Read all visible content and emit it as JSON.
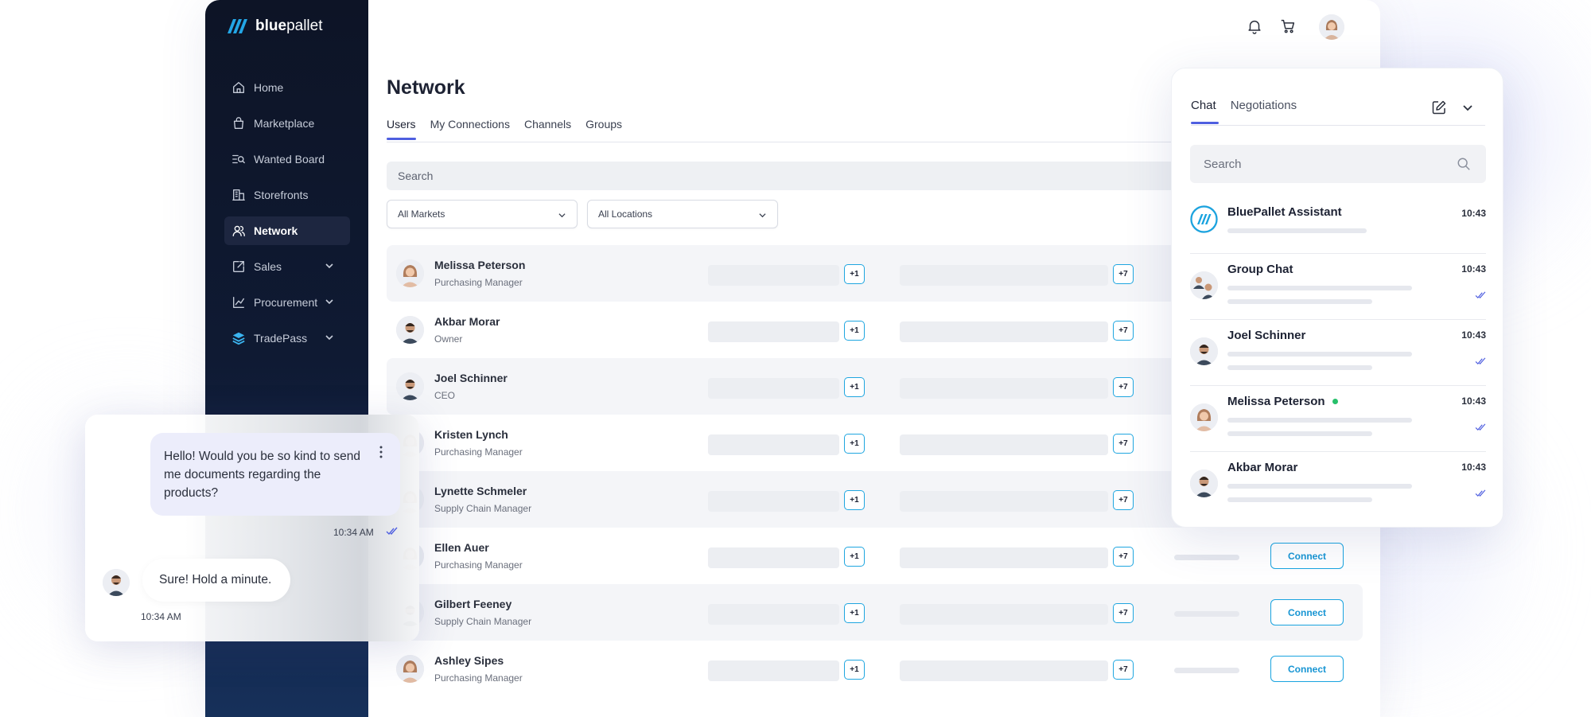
{
  "brand": {
    "name_bold": "blue",
    "name_rest": "pallet"
  },
  "sidebar": {
    "items": [
      {
        "label": "Home",
        "icon": "home-icon",
        "active": false,
        "expandable": false
      },
      {
        "label": "Marketplace",
        "icon": "bag-icon",
        "active": false,
        "expandable": false
      },
      {
        "label": "Wanted Board",
        "icon": "search-list-icon",
        "active": false,
        "expandable": false
      },
      {
        "label": "Storefronts",
        "icon": "building-icon",
        "active": false,
        "expandable": false
      },
      {
        "label": "Network",
        "icon": "users-icon",
        "active": true,
        "expandable": false
      },
      {
        "label": "Sales",
        "icon": "export-icon",
        "active": false,
        "expandable": true
      },
      {
        "label": "Procurement",
        "icon": "chart-icon",
        "active": false,
        "expandable": true
      },
      {
        "label": "TradePass",
        "icon": "tradepass-icon",
        "active": false,
        "expandable": true
      }
    ]
  },
  "header": {
    "icons": [
      "bell-icon",
      "cart-icon",
      "avatar"
    ]
  },
  "main": {
    "title": "Network",
    "tabs": [
      {
        "label": "Users",
        "active": true
      },
      {
        "label": "My Connections",
        "active": false
      },
      {
        "label": "Channels",
        "active": false
      },
      {
        "label": "Groups",
        "active": false
      }
    ],
    "search_placeholder": "Search",
    "filters": [
      "All Markets",
      "All Locations"
    ],
    "rows": [
      {
        "name": "Melissa Peterson",
        "role": "Purchasing Manager",
        "badge1": "+1",
        "badge2": "+7",
        "connect": ""
      },
      {
        "name": "Akbar Morar",
        "role": "Owner",
        "badge1": "+1",
        "badge2": "+7",
        "connect": ""
      },
      {
        "name": "Joel Schinner",
        "role": "CEO",
        "badge1": "+1",
        "badge2": "+7",
        "connect": ""
      },
      {
        "name": "Kristen Lynch",
        "role": "Purchasing Manager",
        "badge1": "+1",
        "badge2": "+7",
        "connect": ""
      },
      {
        "name": "Lynette Schmeler",
        "role": "Supply Chain Manager",
        "badge1": "+1",
        "badge2": "+7",
        "connect": ""
      },
      {
        "name": "Ellen Auer",
        "role": "Purchasing Manager",
        "badge1": "+1",
        "badge2": "+7",
        "connect": "Connect"
      },
      {
        "name": "Gilbert Feeney",
        "role": "Supply Chain Manager",
        "badge1": "+1",
        "badge2": "+7",
        "connect": "Connect"
      },
      {
        "name": "Ashley Sipes",
        "role": "Purchasing Manager",
        "badge1": "+1",
        "badge2": "+7",
        "connect": "Connect"
      }
    ]
  },
  "chat_panel": {
    "tabs": [
      {
        "label": "Chat",
        "active": true
      },
      {
        "label": "Negotiations",
        "active": false
      }
    ],
    "search_placeholder": "Search",
    "conversations": [
      {
        "name": "BluePallet Assistant",
        "time": "10:43",
        "online": false,
        "read": false
      },
      {
        "name": "Group Chat",
        "time": "10:43",
        "online": false,
        "read": true
      },
      {
        "name": "Joel Schinner",
        "time": "10:43",
        "online": false,
        "read": true
      },
      {
        "name": "Melissa Peterson",
        "time": "10:43",
        "online": true,
        "read": true
      },
      {
        "name": "Akbar Morar",
        "time": "10:43",
        "online": false,
        "read": true
      }
    ]
  },
  "conversation": {
    "outgoing": {
      "text": "Hello! Would you be so kind to send me documents regarding the products?",
      "time": "10:34 AM"
    },
    "incoming": {
      "text": "Sure! Hold a minute.",
      "time": "10:34 AM"
    }
  },
  "colors": {
    "accent": "#4f5fe0",
    "brand_blue": "#19a3df",
    "sidebar_bg": "#0d1426",
    "online": "#27c06b"
  }
}
